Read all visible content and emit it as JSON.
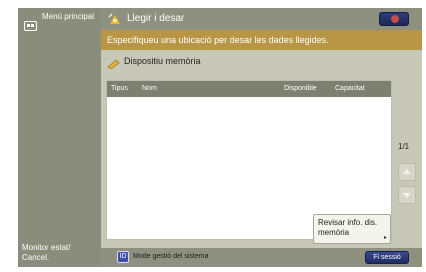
{
  "sidebar": {
    "menu_label": "Menú principal",
    "monitor_label": "Monitor estat/ Cancel."
  },
  "titlebar": {
    "title": "Llegir i desar"
  },
  "instruction": "Especifiqueu una ubicació per desar les dades llegides.",
  "device": {
    "label": "Dispositiu memòria"
  },
  "table": {
    "columns": [
      "Tipus",
      "Nom",
      "Disponible",
      "Capacitat"
    ],
    "rows": []
  },
  "review_button": {
    "label": "Revisar info. dis. memòria"
  },
  "pagination": {
    "page": "1/1"
  },
  "statusbar": {
    "system_mode": "Mode gestió del sistema",
    "logout_label": "Fi sessió"
  },
  "colors": {
    "instruction_bar": "#b99646",
    "panel_gray": "#8e9080",
    "button_blue": "#1f2b63"
  }
}
